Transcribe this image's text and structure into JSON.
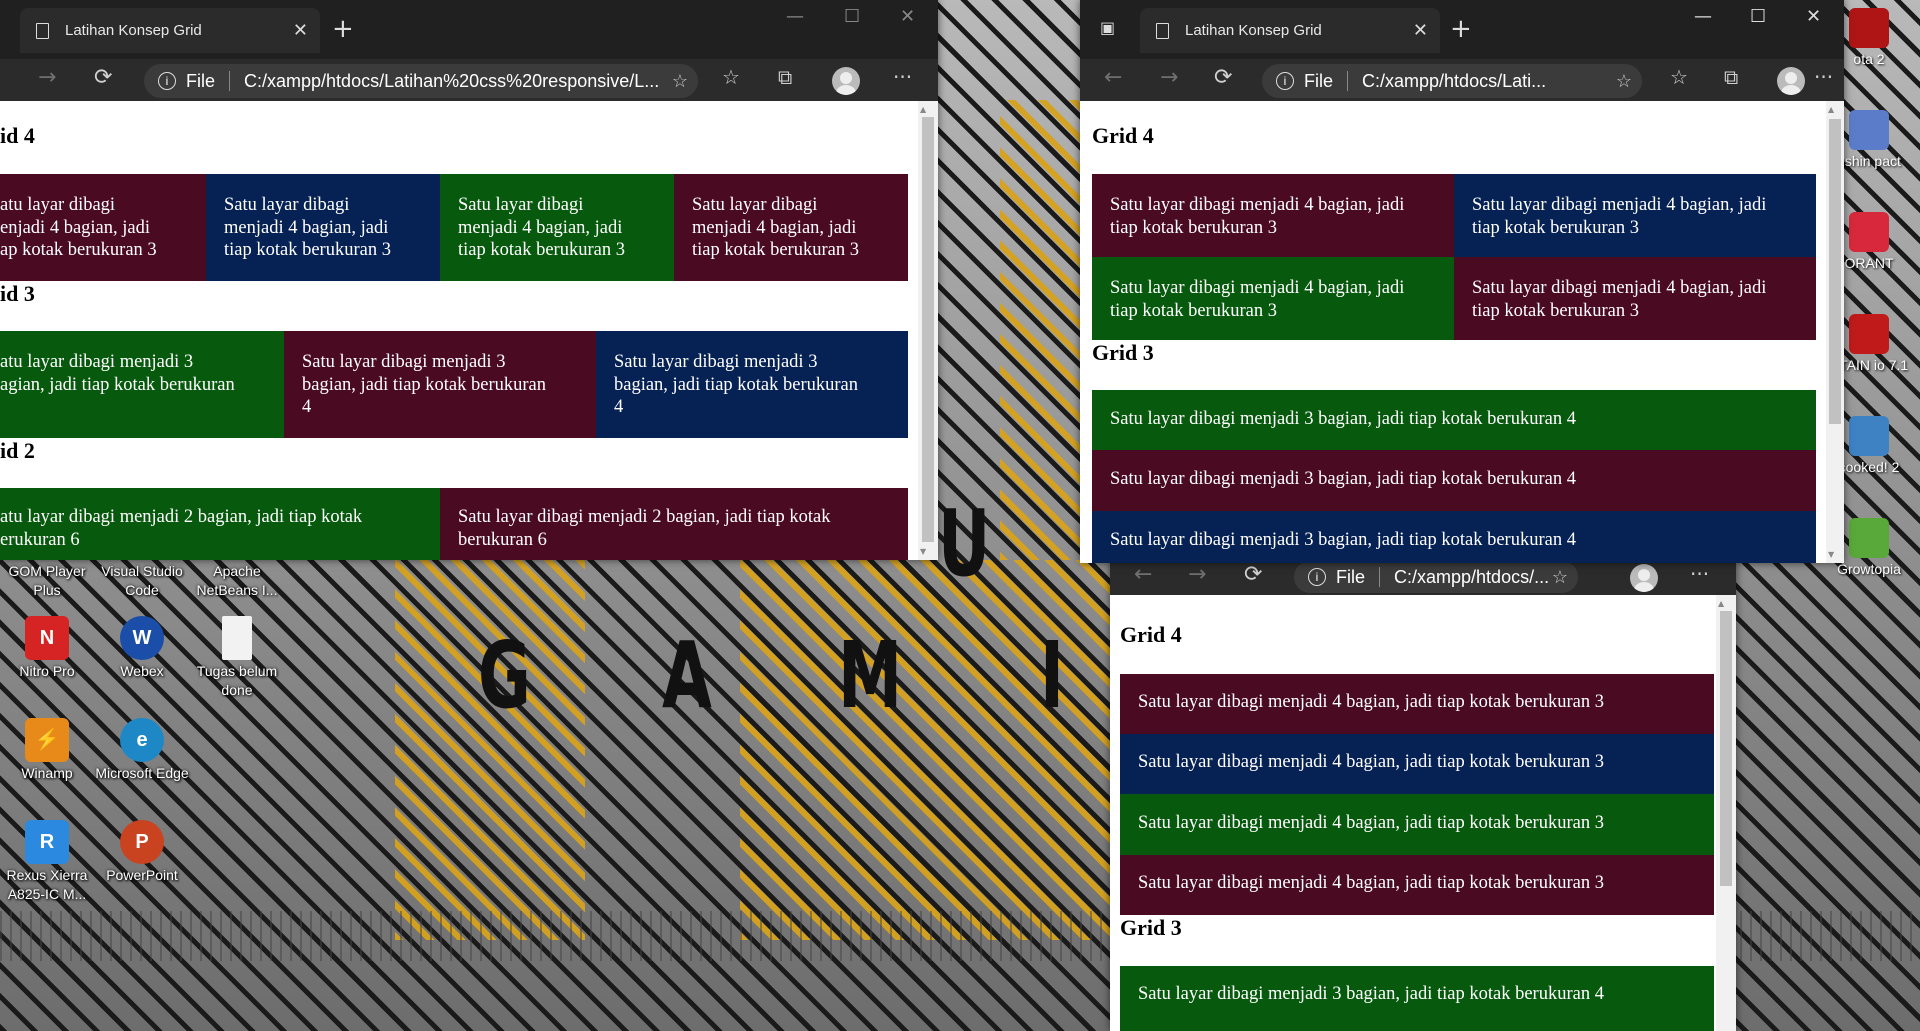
{
  "desktop": {
    "icons_left": [
      {
        "label": "GOM Player Plus",
        "color": "#d23b2b"
      },
      {
        "label": "Visual Studio Code",
        "color": "#1c7fd1"
      },
      {
        "label": "Apache NetBeans I...",
        "color": "#4aa3d8"
      },
      {
        "label": "Nitro Pro",
        "color": "#d62424"
      },
      {
        "label": "Webex",
        "color": "#1b4ea8"
      },
      {
        "label": "Tugas belum done",
        "color": "#eeeeee"
      },
      {
        "label": "Winamp",
        "color": "#e88a1a"
      },
      {
        "label": "Microsoft Edge",
        "color": "#1e88c7"
      },
      {
        "label": "Rexus Xierra A825-IC M...",
        "color": "#2b8ae0"
      },
      {
        "label": "PowerPoint",
        "color": "#c94320"
      }
    ],
    "icons_right": [
      {
        "label": "ota 2",
        "color": "#b01515"
      },
      {
        "label": "nshin pact",
        "color": "#5b7dc9"
      },
      {
        "label": "ORANT",
        "color": "#d8283c"
      },
      {
        "label": "PTAIN io 7.1",
        "color": "#c01a1a"
      },
      {
        "label": "cooked! 2",
        "color": "#3e82c4"
      },
      {
        "label": "Growtopia",
        "color": "#59a83a"
      }
    ],
    "wallpaper_letters": [
      "U",
      "G",
      "A",
      "M",
      "I"
    ]
  },
  "tab_title": "Latihan Konsep Grid",
  "address_scheme": "File",
  "win1": {
    "url": "C:/xampp/htdocs/Latihan%20css%20responsive/L...",
    "grid4_title": "id 4",
    "grid4_cells": [
      "atu layar dibagi\nenjadi 4 bagian, jadi\nap kotak berukuran 3",
      "Satu layar dibagi\nmenjadi 4 bagian, jadi\ntiap kotak berukuran 3",
      "Satu layar dibagi\nmenjadi 4 bagian, jadi\ntiap kotak berukuran 3",
      "Satu layar dibagi\nmenjadi 4 bagian, jadi\ntiap kotak berukuran 3"
    ],
    "grid3_title": "id 3",
    "grid3_cells": [
      "atu layar dibagi menjadi 3\nagian, jadi tiap kotak berukuran",
      "Satu layar dibagi menjadi 3\nbagian, jadi tiap kotak berukuran\n4",
      "Satu layar dibagi menjadi 3\nbagian, jadi tiap kotak berukuran\n4"
    ],
    "grid2_title": "id 2",
    "grid2_cells": [
      "atu layar dibagi menjadi 2 bagian, jadi tiap kotak\nerukuran 6",
      "Satu layar dibagi menjadi 2 bagian, jadi tiap kotak\nberukuran 6"
    ]
  },
  "win2": {
    "url": "C:/xampp/htdocs/Lati...",
    "grid4_title": "Grid 4",
    "grid4_cells": [
      "Satu layar dibagi menjadi 4 bagian, jadi\ntiap kotak berukuran 3",
      "Satu layar dibagi menjadi 4 bagian, jadi\ntiap kotak berukuran 3",
      "Satu layar dibagi menjadi 4 bagian, jadi\ntiap kotak berukuran 3",
      "Satu layar dibagi menjadi 4 bagian, jadi\ntiap kotak berukuran 3"
    ],
    "grid3_title": "Grid 3",
    "grid3_cells": [
      "Satu layar dibagi menjadi 3 bagian, jadi tiap kotak berukuran 4",
      "Satu layar dibagi menjadi 3 bagian, jadi tiap kotak berukuran 4",
      "Satu layar dibagi menjadi 3 bagian, jadi tiap kotak berukuran 4"
    ]
  },
  "win3": {
    "url": "C:/xampp/htdocs/...",
    "grid4_title": "Grid 4",
    "grid4_cells": [
      "Satu layar dibagi menjadi 4 bagian, jadi tiap kotak berukuran 3",
      "Satu layar dibagi menjadi 4 bagian, jadi tiap kotak berukuran 3",
      "Satu layar dibagi menjadi 4 bagian, jadi tiap kotak berukuran 3",
      "Satu layar dibagi menjadi 4 bagian, jadi tiap kotak berukuran 3"
    ],
    "grid3_title": "Grid 3",
    "grid3_cells": [
      "Satu layar dibagi menjadi 3 bagian, jadi tiap kotak berukuran 4"
    ]
  },
  "colors": {
    "maroon": "#4a0a22",
    "navy": "#062153",
    "green": "#075a0d",
    "wallpaper_stripe": "#d7a21c"
  }
}
